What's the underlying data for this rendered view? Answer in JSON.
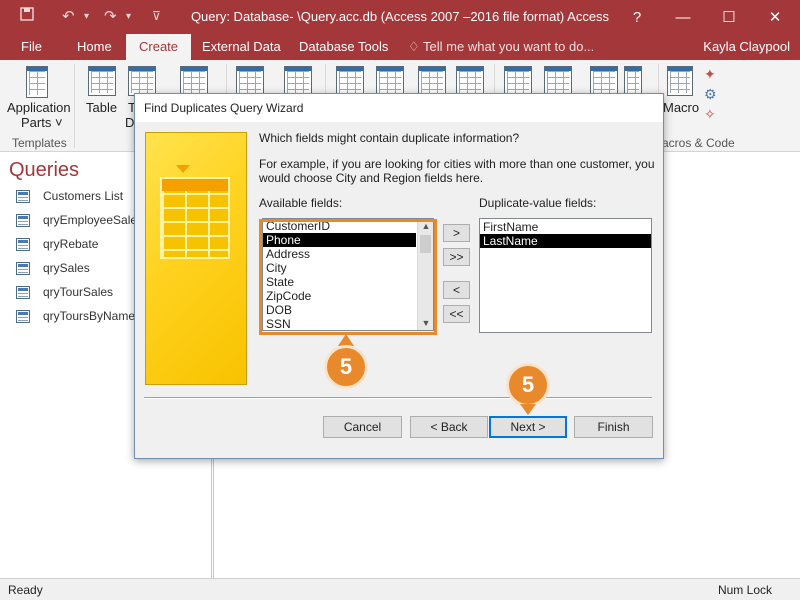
{
  "window": {
    "title": "Query: Database- \\Query.acc.db (Access 2007 –2016 file format) Access"
  },
  "ribbon_tabs": {
    "file": "File",
    "home": "Home",
    "create": "Create",
    "external_data": "External Data",
    "database_tools": "Database Tools",
    "tell_me": "♢ Tell me what you want to do...",
    "user": "Kayla Claypool"
  },
  "ribbon": {
    "application_parts": "Application",
    "application_parts_2": "Parts ˅",
    "templates_group": "Templates",
    "table": "Table",
    "table_design_partial": "T",
    "table_design_partial_2": "D",
    "macro": "Macro",
    "macros_group_partial": "acros & Code"
  },
  "nav": {
    "header": "Queries",
    "items": [
      "Customers List",
      "qryEmployeeSales",
      "qryRebate",
      "qrySales",
      "qryTourSales",
      "qryToursByName"
    ]
  },
  "status": {
    "left": "Ready",
    "right": "Num Lock"
  },
  "dialog": {
    "title": "Find Duplicates Query Wizard",
    "question": "Which fields might contain duplicate information?",
    "example_line1": "For example, if you are looking for cities with more than one customer, you",
    "example_line2": "would choose City and Region fields here.",
    "available_label": "Available fields:",
    "duplicate_label": "Duplicate-value fields:",
    "available_fields": [
      "CustomerID",
      "Phone",
      "Address",
      "City",
      "State",
      "ZipCode",
      "DOB",
      "SSN"
    ],
    "available_selected": "Phone",
    "duplicate_fields": [
      "FirstName",
      "LastName"
    ],
    "duplicate_selected": "LastName",
    "move_one": ">",
    "move_all": ">>",
    "remove_one": "<",
    "remove_all": "<<",
    "cancel": "Cancel",
    "back": "< Back",
    "next": "Next >",
    "finish": "Finish"
  },
  "callouts": {
    "list_step": "5",
    "next_step": "5"
  },
  "colors": {
    "accent": "#a4373a",
    "callout": "#e8892c"
  }
}
